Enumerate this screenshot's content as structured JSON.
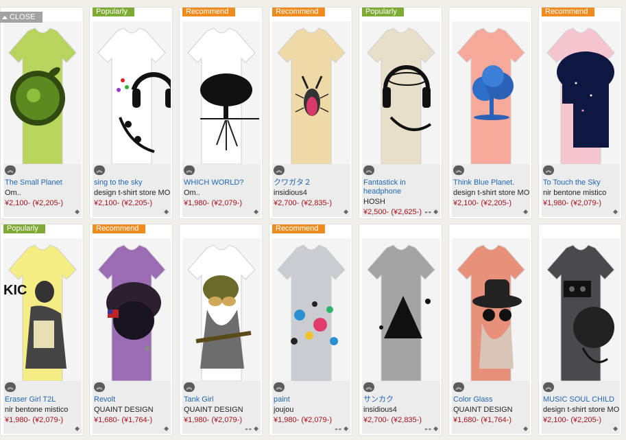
{
  "close_label": "CLOSE",
  "items": [
    {
      "tag": "",
      "tag_type": "",
      "title": "The Small Planet",
      "shop": "Om..",
      "price": "¥2,100- (¥2,205-)",
      "shirt": "#b9d45d",
      "art": "leaf",
      "icons": "tag"
    },
    {
      "tag": "Popularly",
      "tag_type": "popularly",
      "title": "sing to the sky",
      "shop": "design t-shirt store MO",
      "price": "¥2,100- (¥2,205-)",
      "shirt": "#ffffff",
      "art": "headphones",
      "icons": "tag"
    },
    {
      "tag": "Recommend",
      "tag_type": "recommend",
      "title": "WHICH WORLD?",
      "shop": "Om..",
      "price": "¥1,980- (¥2,079-)",
      "shirt": "#ffffff",
      "art": "tree",
      "icons": "tag"
    },
    {
      "tag": "Recommend",
      "tag_type": "recommend",
      "title": "クワガタ２",
      "shop": "insidious4",
      "price": "¥2,700- (¥2,835-)",
      "shirt": "#efd9a6",
      "art": "beetle",
      "icons": "tag"
    },
    {
      "tag": "Popularly",
      "tag_type": "popularly",
      "title": "Fantastick in headphone",
      "shop": "HOSH",
      "price": "¥2,500- (¥2,625-)",
      "shirt": "#e7dfc8",
      "art": "hosh",
      "icons": "pair"
    },
    {
      "tag": "",
      "tag_type": "",
      "title": "Think Blue Planet.",
      "shop": "design t-shirt store MO",
      "price": "¥2,100- (¥2,205-)",
      "shirt": "#f6a89a",
      "art": "bluetree",
      "icons": "tag"
    },
    {
      "tag": "Recommend",
      "tag_type": "recommend",
      "title": "To Touch the Sky",
      "shop": "nir bentone mistico",
      "price": "¥1,980- (¥2,079-)",
      "shirt": "#f7c5cf",
      "art": "sky",
      "icons": "tag"
    },
    {
      "tag": "Popularly",
      "tag_type": "popularly",
      "title": "Eraser Girl T2L",
      "shop": "nir bentone mistico",
      "price": "¥1,980- (¥2,079-)",
      "shirt": "#f5ed84",
      "art": "girl",
      "icons": "tag"
    },
    {
      "tag": "Recommend",
      "tag_type": "recommend",
      "title": "Revolt",
      "shop": "QUAINT DESIGN",
      "price": "¥1,680- (¥1,764-)",
      "shirt": "#9b6cb4",
      "art": "skull",
      "icons": "tag"
    },
    {
      "tag": "",
      "tag_type": "",
      "title": "Tank Girl",
      "shop": "QUAINT DESIGN",
      "price": "¥1,980- (¥2,079-)",
      "shirt": "#ffffff",
      "art": "tankgirl",
      "icons": "pair"
    },
    {
      "tag": "Recommend",
      "tag_type": "recommend",
      "title": "paint",
      "shop": "joujou",
      "price": "¥1,980- (¥2,079-)",
      "shirt": "#c9ccd0",
      "art": "paint",
      "icons": "pair"
    },
    {
      "tag": "",
      "tag_type": "",
      "title": "サンカク",
      "shop": "insidious4",
      "price": "¥2,700- (¥2,835-)",
      "shirt": "#a4a4a4",
      "art": "triangle",
      "icons": "pair"
    },
    {
      "tag": "",
      "tag_type": "",
      "title": "Color Glass",
      "shop": "QUAINT DESIGN",
      "price": "¥1,680- (¥1,764-)",
      "shirt": "#e9907b",
      "art": "hat",
      "icons": "tag"
    },
    {
      "tag": "",
      "tag_type": "",
      "title": "MUSIC SOUL CHILD",
      "shop": "design t-shirt store MO",
      "price": "¥2,100- (¥2,205-)",
      "shirt": "#4a4a4c",
      "art": "cassette",
      "icons": "tag"
    }
  ]
}
